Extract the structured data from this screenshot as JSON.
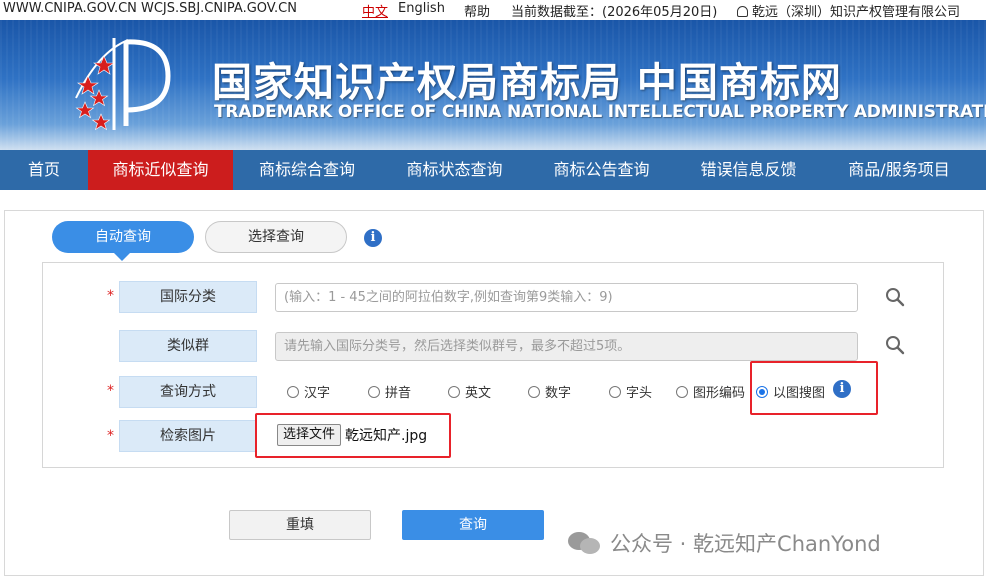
{
  "topbar": {
    "sites": "WWW.CNIPA.GOV.CN WCJS.SBJ.CNIPA.GOV.CN",
    "lang_cn": "中文",
    "lang_en": "English",
    "help": "帮助",
    "data_date": "当前数据截至：(2026年05月20日)",
    "user": "乾远（深圳）知识产权管理有限公司"
  },
  "banner": {
    "title_cn": "国家知识产权局商标局 中国商标网",
    "title_en": "TRADEMARK OFFICE OF CHINA NATIONAL INTELLECTUAL PROPERTY ADMINISTRATION"
  },
  "nav": {
    "items": [
      "首页",
      "商标近似查询",
      "商标综合查询",
      "商标状态查询",
      "商标公告查询",
      "错误信息反馈",
      "商品/服务项目"
    ],
    "active_index": 1
  },
  "tabs": {
    "auto": "自动查询",
    "select": "选择查询",
    "info_glyph": "i"
  },
  "form": {
    "required_mark": "*",
    "intl_class": {
      "label": "国际分类",
      "placeholder": "(输入：1 - 45之间的阿拉伯数字,例如查询第9类输入：9)"
    },
    "similar_group": {
      "label": "类似群",
      "placeholder": "请先输入国际分类号，然后选择类似群号，最多不超过5项。"
    },
    "query_method": {
      "label": "查询方式",
      "options": [
        "汉字",
        "拼音",
        "英文",
        "数字",
        "字头",
        "图形编码",
        "以图搜图"
      ],
      "selected": "以图搜图"
    },
    "search_image": {
      "label": "检索图片",
      "button": "选择文件",
      "file_name": "乾远知产.jpg"
    }
  },
  "buttons": {
    "reset": "重填",
    "query": "查询"
  },
  "watermark": {
    "text": "公众号 · 乾远知产ChanYond"
  },
  "colors": {
    "nav_bg": "#2e6aa8",
    "nav_active": "#cc1d1d",
    "primary": "#3a8ee6",
    "highlight": "#e8222a",
    "label_bg": "#dbeaf8"
  }
}
